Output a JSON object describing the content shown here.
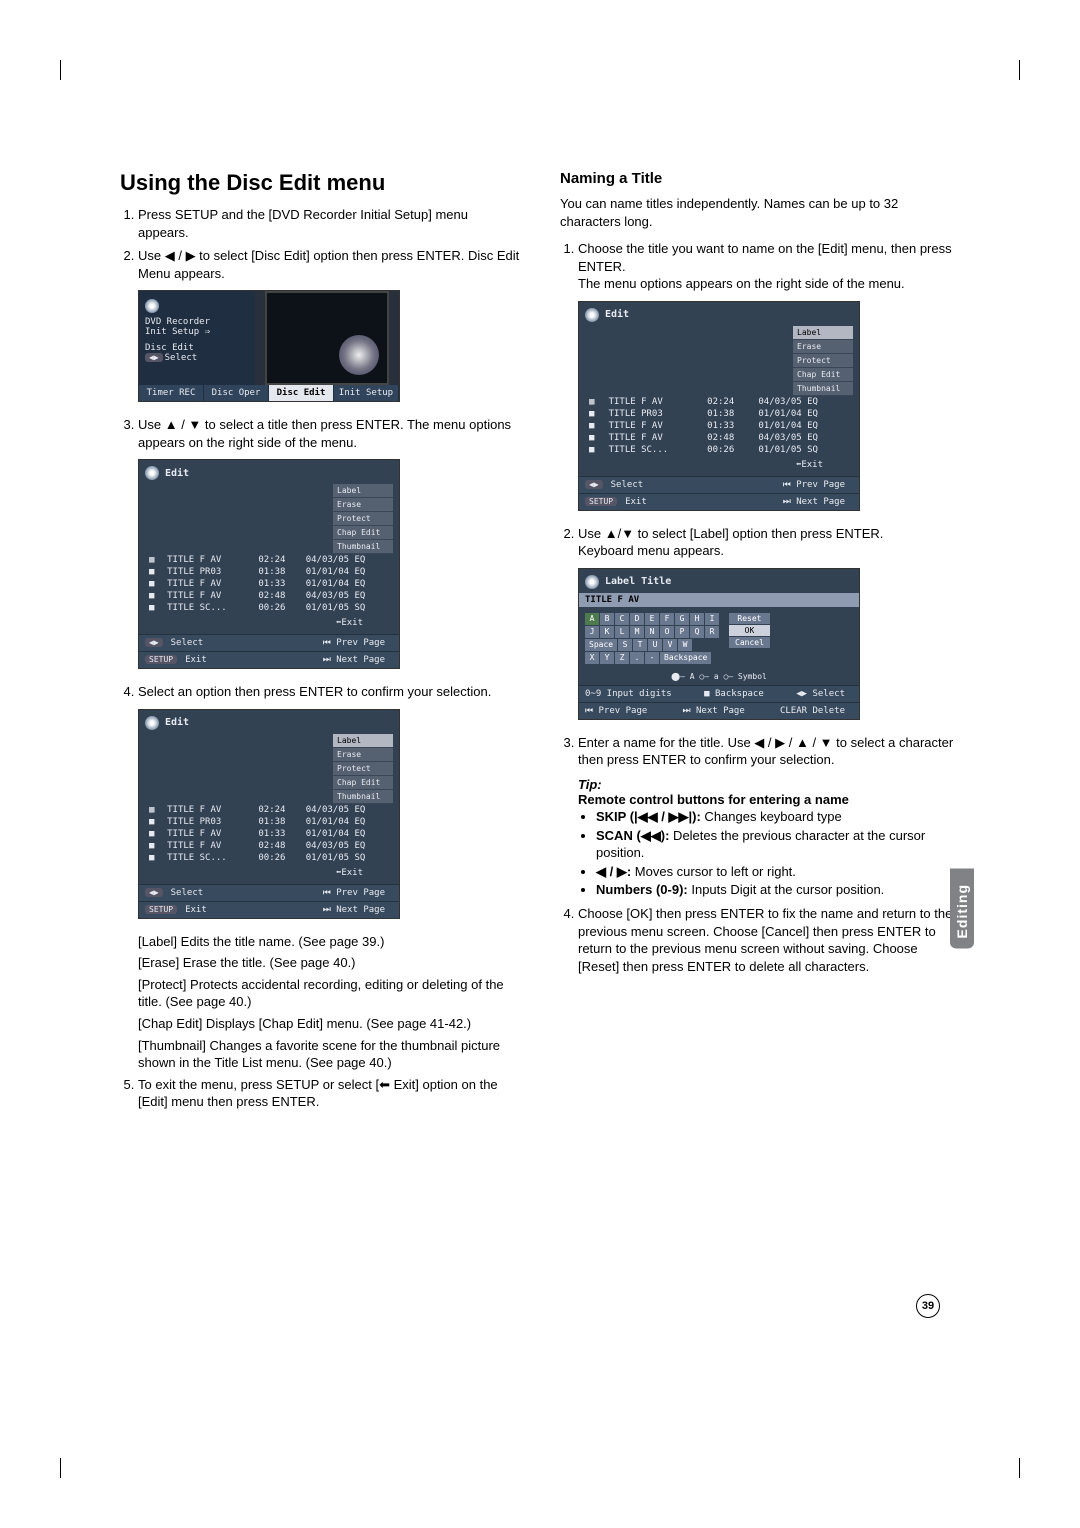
{
  "page_number": "39",
  "side_tab": "Editing",
  "left": {
    "heading": "Using the Disc Edit menu",
    "step1": "Press SETUP and the [DVD Recorder Initial Setup] menu appears.",
    "step2": "Use ◀ / ▶ to select [Disc Edit] option then press ENTER. Disc Edit Menu appears.",
    "step3": "Use ▲ / ▼ to select a title then press ENTER. The menu options appears on the right side of the menu.",
    "step4": "Select an option then press ENTER to confirm your selection.",
    "notes": [
      "[Label] Edits the title name. (See page 39.)",
      "[Erase] Erase the title. (See page 40.)",
      "[Protect] Protects accidental recording, editing or deleting of the title. (See page 40.)",
      "[Chap Edit] Displays [Chap Edit] menu. (See page 41-42.)",
      "[Thumbnail] Changes a favorite scene for the thumbnail picture shown in the Title List menu. (See page 40.)"
    ],
    "step5": "To exit the menu, press SETUP or select [⬅ Exit] option on the [Edit] menu then press ENTER."
  },
  "right": {
    "heading": "Naming a Title",
    "intro": "You can name titles independently. Names can be up to 32 characters long.",
    "step1a": "Choose the title you want to name on the [Edit] menu, then press ENTER.",
    "step1b": "The menu options appears on the right side of the menu.",
    "step2a": "Use ▲/▼ to select [Label] option then press ENTER.",
    "step2b": "Keyboard menu appears.",
    "step3": "Enter a name for the title. Use ◀ / ▶ / ▲ / ▼ to select a character then press ENTER to confirm your selection.",
    "tip_label": "Tip:",
    "tip_sub": "Remote control buttons for entering a name",
    "tips": [
      {
        "bold": "SKIP (|◀◀ / ▶▶|):",
        "rest": " Changes keyboard type"
      },
      {
        "bold": "SCAN (◀◀):",
        "rest": " Deletes the previous character at the cursor position."
      },
      {
        "bold": "◀ / ▶:",
        "rest": " Moves cursor to left or right."
      },
      {
        "bold": "Numbers (0-9):",
        "rest": " Inputs Digit at the cursor position."
      }
    ],
    "step4": "Choose [OK] then press ENTER to fix the name and return to the previous menu screen. Choose [Cancel] then press ENTER to return to the previous menu screen without saving. Choose [Reset] then press ENTER to delete all characters."
  },
  "fig_init": {
    "lines": [
      "DVD Recorder",
      "Init Setup ⇒",
      "",
      "Disc Edit",
      "◀▶ Select"
    ],
    "tabs": [
      "Timer REC",
      "Disc Oper",
      "Disc Edit",
      "Init Setup"
    ]
  },
  "fig_edit": {
    "header": "Edit",
    "rows": [
      {
        "t": "TITLE F AV",
        "d": "02:24",
        "s": "04/03/05 EQ"
      },
      {
        "t": "TITLE PR03",
        "d": "01:38",
        "s": "01/01/04 EQ"
      },
      {
        "t": "TITLE F AV",
        "d": "01:33",
        "s": "01/01/04 EQ"
      },
      {
        "t": "TITLE F AV",
        "d": "02:48",
        "s": "04/03/05 EQ"
      },
      {
        "t": "TITLE SC...",
        "d": "00:26",
        "s": "01/01/05 SQ"
      }
    ],
    "menu": [
      "Label",
      "Erase",
      "Protect",
      "Chap Edit",
      "Thumbnail"
    ],
    "exit": "⬅Exit",
    "bar_l1": "◀▶ Select",
    "bar_l2": "SETUP Exit",
    "bar_r1": "⏮ Prev Page",
    "bar_r2": "⏭ Next Page"
  },
  "fig_kbd": {
    "header": "Label Title",
    "title": "TITLE F AV",
    "row1": [
      "A",
      "B",
      "C",
      "D",
      "E",
      "F",
      "G",
      "H",
      "I"
    ],
    "row2": [
      "J",
      "K",
      "L",
      "M",
      "N",
      "O",
      "P",
      "Q",
      "R"
    ],
    "row3": [
      "Space",
      "S",
      "T",
      "U",
      "V",
      "W"
    ],
    "row4": [
      "X",
      "Y",
      "Z",
      ".",
      "-",
      "Backspace"
    ],
    "right": [
      "Reset",
      "OK",
      "Cancel"
    ],
    "legend": "⬤— A    ○— a    ○— Symbol",
    "bar_l1": "0~9 Input digits",
    "bar_l2": "⏮ Prev Page",
    "bar_m1": "■ Backspace",
    "bar_m2": "⏭ Next Page",
    "bar_r1": "◀▶ Select",
    "bar_r2": "CLEAR Delete"
  }
}
